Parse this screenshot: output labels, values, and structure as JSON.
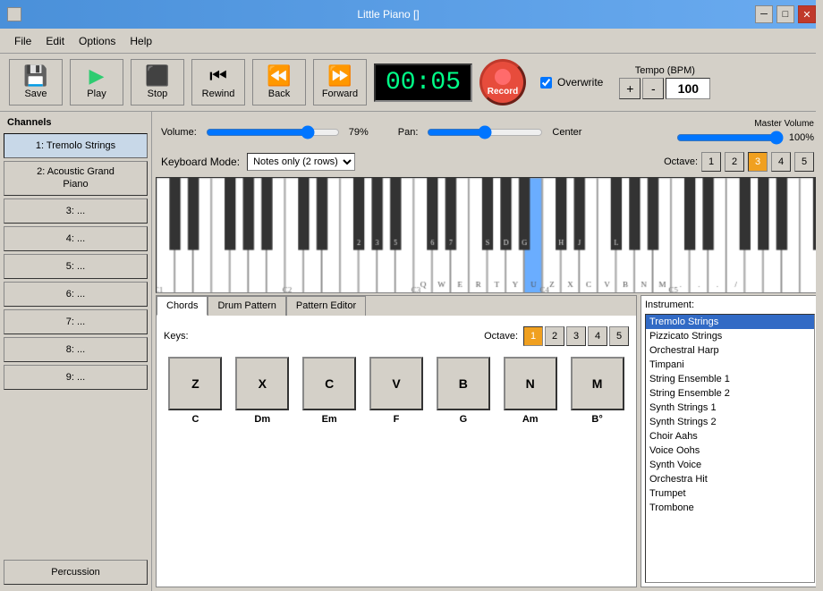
{
  "titlebar": {
    "title": "Little Piano []",
    "minimize": "─",
    "maximize": "□",
    "close": "✕"
  },
  "menu": {
    "items": [
      "File",
      "Edit",
      "Options",
      "Help"
    ]
  },
  "toolbar": {
    "save_label": "Save",
    "play_label": "Play",
    "stop_label": "Stop",
    "rewind_label": "Rewind",
    "back_label": "Back",
    "forward_label": "Forward",
    "record_label": "Record",
    "time": "00:05",
    "overwrite_label": "Overwrite",
    "tempo_label": "Tempo (BPM)",
    "tempo_plus": "+",
    "tempo_minus": "-",
    "tempo_value": "100"
  },
  "volume": {
    "label": "Volume:",
    "value": "79%",
    "pan_label": "Pan:",
    "pan_value": "Center",
    "master_label": "Master Volume",
    "master_value": "100%"
  },
  "keyboard": {
    "mode_label": "Keyboard Mode:",
    "mode_value": "Notes only (2 rows)",
    "octave_label": "Octave:",
    "octave_buttons": [
      "1",
      "2",
      "3",
      "4",
      "5"
    ],
    "active_octave": "3"
  },
  "channels": {
    "title": "Channels",
    "items": [
      "1: Tremolo Strings",
      "2: Acoustic Grand\nPiano",
      "3: ...",
      "4: ...",
      "5: ...",
      "6: ...",
      "7: ...",
      "8: ...",
      "9: ...",
      "Percussion"
    ]
  },
  "piano": {
    "white_keys": [
      "C1",
      "",
      "",
      "",
      "",
      "C2",
      "",
      "",
      "",
      "",
      "",
      "",
      "C3",
      "",
      "",
      "",
      "",
      "",
      "",
      "",
      "",
      "",
      "",
      "C4",
      "",
      "",
      "",
      "",
      "",
      "",
      "",
      "C5"
    ],
    "key_labels_bottom": [
      "Q",
      "W",
      "E",
      "R",
      "T",
      "Y",
      "U",
      "Z",
      "X",
      "C",
      "V",
      "B",
      "N",
      "M",
      ".",
      ".",
      "∙",
      "/"
    ],
    "active_key": "U",
    "c_labels": [
      "C1",
      "C2",
      "C3",
      "C4",
      "C5"
    ]
  },
  "tabs": {
    "items": [
      "Chords",
      "Drum Pattern",
      "Pattern Editor"
    ],
    "active": "Chords"
  },
  "chords": {
    "keys_label": "Keys:",
    "octave_label": "Octave:",
    "octave_buttons": [
      "1",
      "2",
      "3",
      "4",
      "5"
    ],
    "active_octave": "1",
    "chord_keys": [
      {
        "key": "Z",
        "chord": "C"
      },
      {
        "key": "X",
        "chord": "Dm"
      },
      {
        "key": "C",
        "chord": "Em"
      },
      {
        "key": "V",
        "chord": "F"
      },
      {
        "key": "B",
        "chord": "G"
      },
      {
        "key": "N",
        "chord": "Am"
      },
      {
        "key": "M",
        "chord": "B°"
      }
    ]
  },
  "instruments": {
    "label": "Instrument:",
    "items": [
      "Tremolo Strings",
      "Pizzicato Strings",
      "Orchestral Harp",
      "Timpani",
      "String Ensemble 1",
      "String Ensemble 2",
      "Synth Strings 1",
      "Synth Strings 2",
      "Choir Aahs",
      "Voice Oohs",
      "Synth Voice",
      "Orchestra Hit",
      "Trumpet",
      "Trombone"
    ],
    "selected": "Tremolo Strings"
  }
}
